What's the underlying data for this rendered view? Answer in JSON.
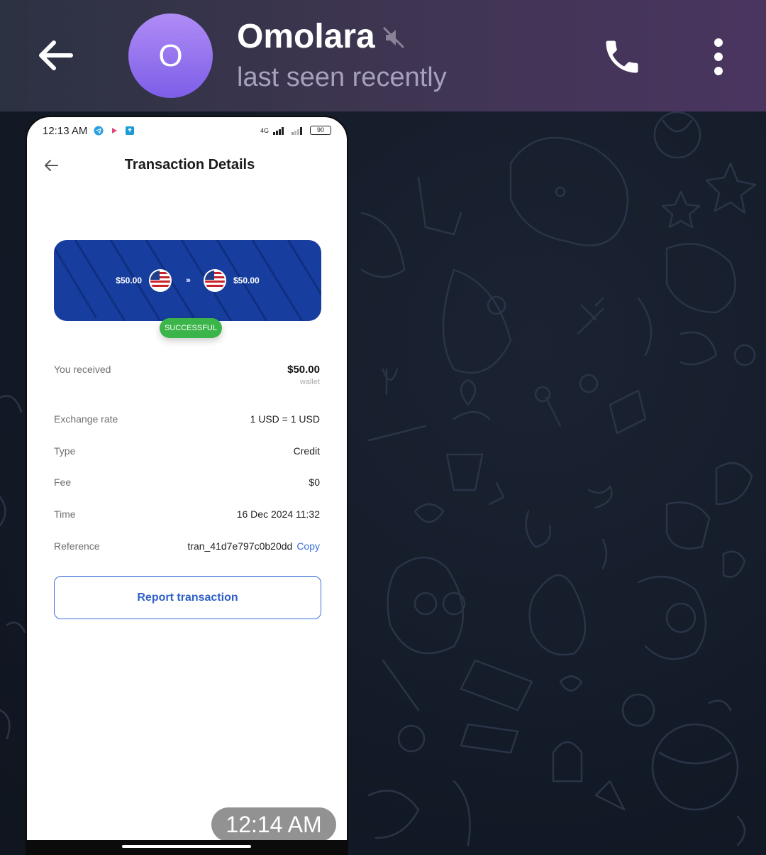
{
  "header": {
    "back_icon": "arrow-left-icon",
    "avatar_letter": "O",
    "contact_name": "Omolara",
    "mute_icon": "muted-speaker-icon",
    "status": "last seen recently",
    "call_icon": "phone-icon",
    "menu_icon": "more-vertical-icon"
  },
  "message": {
    "time": "12:14 AM",
    "screenshot": {
      "status_bar": {
        "time": "12:13 AM",
        "network": "4G",
        "battery": "90"
      },
      "title": "Transaction Details",
      "card": {
        "from_amount": "$50.00",
        "to_amount": "$50.00",
        "status": "SUCCESSFUL"
      },
      "details": {
        "received_label": "You received",
        "received_value": "$50.00",
        "received_note": "wallet",
        "rate_label": "Exchange rate",
        "rate_value": "1 USD =  1 USD",
        "type_label": "Type",
        "type_value": "Credit",
        "fee_label": "Fee",
        "fee_value": "$0",
        "time_label": "Time",
        "time_value": "16 Dec 2024 11:32",
        "reference_label": "Reference",
        "reference_value": "tran_41d7e797c0b20dd",
        "copy_label": "Copy"
      },
      "report_button": "Report transaction"
    }
  },
  "colors": {
    "header_start": "#2c3242",
    "header_end": "#4a3560",
    "avatar": "#9a77f0",
    "card_blue": "#173e9e",
    "success_green": "#3bb54a",
    "link_blue": "#3a6fd8"
  }
}
